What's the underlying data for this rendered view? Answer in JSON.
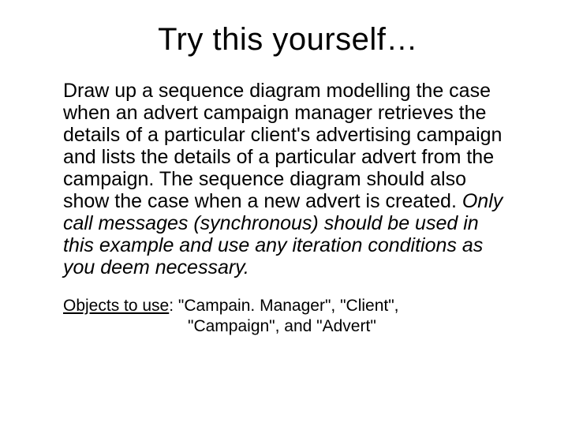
{
  "title": "Try this yourself…",
  "body": {
    "part1": "Draw up a sequence diagram modelling the case when an advert campaign manager retrieves the details of a particular client's advertising campaign and lists the details of a particular advert from the campaign. The sequence diagram should also show the case when a new advert is created. ",
    "part2_italic": "Only call messages (synchronous) should be used in this example and use any iteration conditions as you deem necessary."
  },
  "objects": {
    "label": "Objects to use",
    "colon_sep": ": ",
    "line1": "\"Campain. Manager\", \"Client\",",
    "line2": "\"Campaign\", and \"Advert\""
  }
}
